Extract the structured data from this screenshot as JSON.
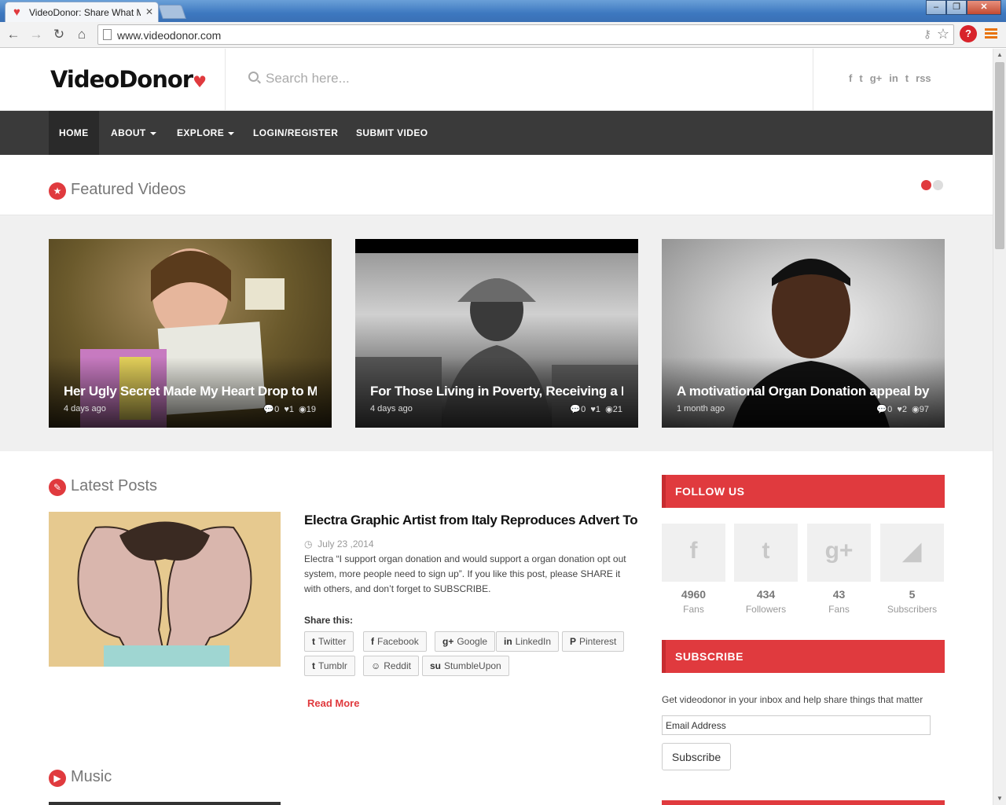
{
  "browser": {
    "tab_title": "VideoDonor: Share What M",
    "url": "www.videodonor.com",
    "window_buttons": [
      "‒",
      "❐",
      "✕"
    ]
  },
  "site": {
    "logo": "VideoDonor",
    "search_placeholder": "Search here...",
    "social_icons": [
      "f",
      "t",
      "g+",
      "in",
      "t",
      "rss"
    ]
  },
  "nav": {
    "items": [
      "HOME",
      "ABOUT",
      "EXPLORE",
      "LOGIN/REGISTER",
      "SUBMIT VIDEO"
    ]
  },
  "featured": {
    "title": "Featured Videos",
    "cards": [
      {
        "title": "Her Ugly Secret Made My Heart Drop to M",
        "date": "4 days ago",
        "comments": "0",
        "likes": "1",
        "views": "19"
      },
      {
        "title": "For Those Living in Poverty, Receiving a Ba",
        "date": "4 days ago",
        "comments": "0",
        "likes": "1",
        "views": "21"
      },
      {
        "title": "A motivational Organ Donation appeal by I",
        "date": "1 month ago",
        "comments": "0",
        "likes": "2",
        "views": "97"
      }
    ]
  },
  "latest": {
    "title": "Latest Posts",
    "post": {
      "title": "Electra Graphic Artist from Italy Reproduces Advert To A",
      "date": "July 23 ,2014",
      "excerpt": "Electra “I support organ donation and would support a organ donation opt out system, more people need to sign up”.  If you like this post, please SHARE it with others, and don’t forget to SUBSCRIBE.",
      "share_label": "Share this:",
      "share_buttons": [
        "Twitter",
        "Facebook",
        "Google",
        "LinkedIn",
        "Pinterest",
        "Tumblr",
        "Reddit",
        "StumbleUpon"
      ],
      "read_more": "Read More"
    }
  },
  "music": {
    "title": "Music"
  },
  "follow": {
    "title": "FOLLOW US",
    "items": [
      {
        "icon": "facebook-icon",
        "count": "4960",
        "unit": "Fans"
      },
      {
        "icon": "twitter-icon",
        "count": "434",
        "unit": "Followers"
      },
      {
        "icon": "google-plus-icon",
        "count": "43",
        "unit": "Fans"
      },
      {
        "icon": "rss-icon",
        "count": "5",
        "unit": "Subscribers"
      }
    ]
  },
  "subscribe": {
    "title": "SUBSCRIBE",
    "text": "Get videodonor in your inbox and help share things that matter",
    "input_value": "Email Address",
    "button": "Subscribe"
  },
  "colors": {
    "accent": "#e03a3e",
    "nav_bg": "#3a3a3a"
  }
}
